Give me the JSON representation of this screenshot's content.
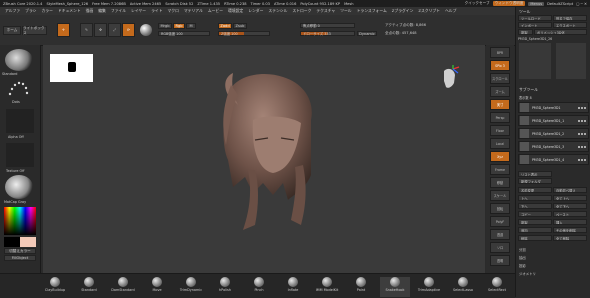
{
  "title_bar": {
    "app": "ZBrush Core 2020.1.4",
    "mesh": "StyleMesh_Sphere_126",
    "free_mem": "Free Mem 7.2086B",
    "active_mem": "Active Mem 2465",
    "scratch": "Scratch Disk 52",
    "ztime": "ZTime 1.435",
    "rtime": "RTime 0.238",
    "timer": "Timer 0.03",
    "atime": "ATime 0.016",
    "poly_count": "PolyCount 952.189 KP",
    "mesh_count": "Mesh",
    "quicksave": "クイックセーブ",
    "window_transparency": "ウィンドウ透明度",
    "menu_label": "Menus",
    "script": "DefaultZScript"
  },
  "menu_bar": [
    "アルファ",
    "ブラシ",
    "カラー",
    "ドキュメント",
    "描画",
    "編集",
    "ファイル",
    "レイヤー",
    "ライト",
    "マクロ",
    "マテリアル",
    "ムービー",
    "環境設定",
    "レンダー",
    "ステンシル",
    "ストローク",
    "テクスチャ",
    "ツール",
    "トランスフォーム",
    "Zプラグイン",
    "Zスクリプト",
    "ヘルプ"
  ],
  "top_toolbar": {
    "home": "ホーム",
    "lightbox": "ライトボックス",
    "edit": "Edit",
    "draw": "描画",
    "move": "移動",
    "scale": "拡大",
    "rotate": "回転",
    "mrgb": "Mrgb",
    "rgb": "Rgb",
    "m": "M",
    "zadd": "Zadd",
    "zsub": "Zsub",
    "rgb_intensity": "RGB強度 100",
    "z_intensity": "Z強度 100",
    "focal_shift": "焦点移動 0",
    "draw_size": "ドローサイズ 333",
    "dynamic": "Dynamic",
    "active_points": "アクティブ点の数: 8,866",
    "total_points": "全点の数: 457,648"
  },
  "left_panel": {
    "standard": "Standard",
    "dots": "Dots",
    "alpha_off": "Alpha Off",
    "texture_off": "Texture Off",
    "matcap": "MatCap Gray",
    "switch_color": "切替えカラー",
    "fill_object": "FillObject"
  },
  "right_icons": [
    "BPR",
    "SPix 3",
    "スクロール",
    "ズーム",
    "実寸",
    "Persp",
    "Floor",
    "Local",
    "Xyz",
    "Frame",
    "移動",
    "スケール",
    "回転",
    "PolyF",
    "透過",
    "ソロ",
    "透明"
  ],
  "tray": {
    "header": "ツール",
    "load_tool": "ツールロード",
    "save_as": "別名で保存",
    "import": "インポート",
    "export": "エクスポート",
    "clone": "複製",
    "make_polymesh": "ポリメッシュ3D化",
    "tool_name": "PM3D_Sphere3D1_26",
    "subtool_header": "サブツール",
    "visible_count": "表示数 8",
    "subtools": [
      "PM3D_Sphere3D1",
      "PM3D_Sphere3D1_1",
      "PM3D_Sphere3D1_2",
      "PM3D_Sphere3D1_3",
      "PM3D_Sphere3D1_4"
    ],
    "list_all": "リスト表示",
    "new_folder": "新規フォルダ",
    "buttons": [
      "名前変更",
      "自動並べ替え",
      "上へ",
      "全て上へ",
      "下へ",
      "全て下へ",
      "コピー",
      "ペースト",
      "複製",
      "挿入",
      "追加",
      "その他を削除",
      "削除",
      "全て削除"
    ],
    "sections": [
      "分割",
      "抽出",
      "投影",
      "ジオメトリ"
    ]
  },
  "bottom_shelf": [
    "ClayBuildup",
    "Standard",
    "DamStandard",
    "Move",
    "TrimDynamic",
    "hPolish",
    "Pinch",
    "Inflate",
    "IMM ModelKit",
    "Paint",
    "SnakeHook",
    "TrimAdaptive",
    "SelectLasso",
    "SelectRect"
  ]
}
